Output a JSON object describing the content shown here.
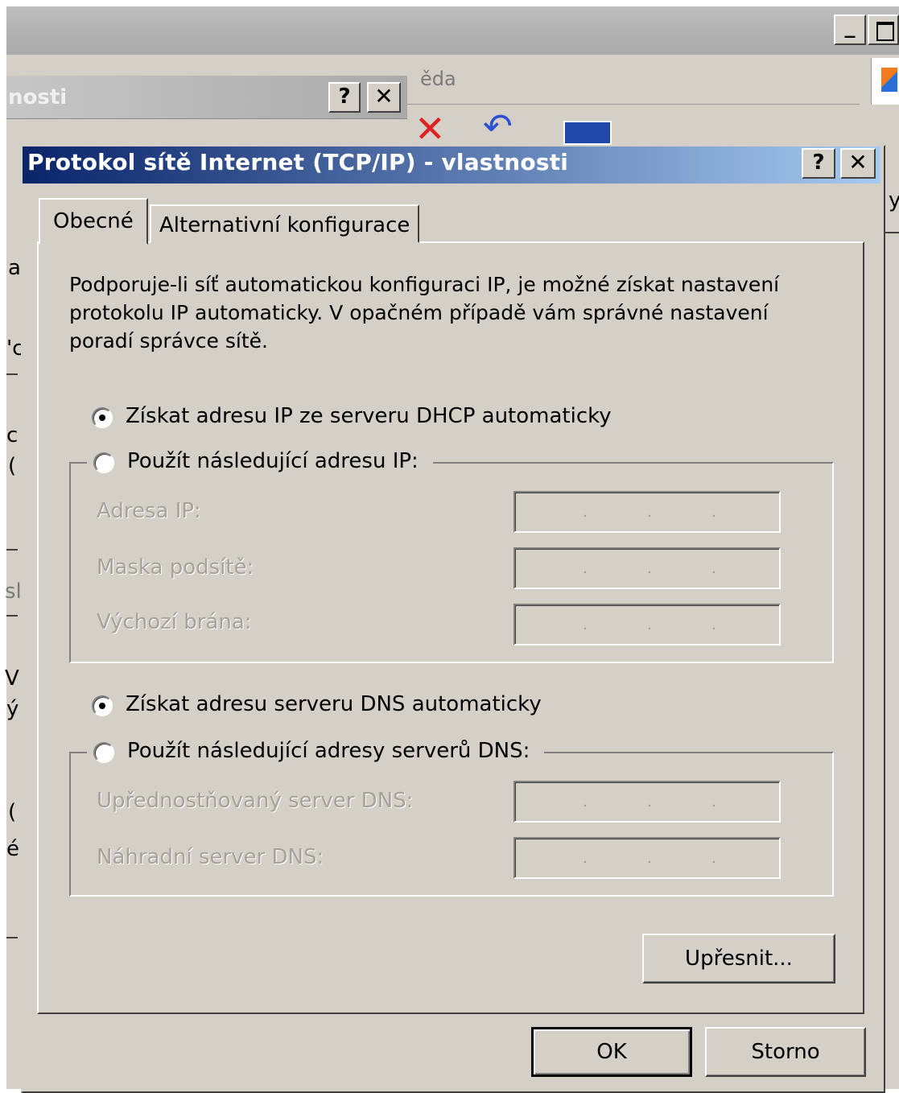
{
  "background": {
    "menu_fragment": "ěda",
    "properties_title_fragment": "nosti",
    "help_symbol": "?",
    "close_symbol": "✕",
    "minimize_symbol": "_",
    "left_edge_fragments": [
      "a",
      "'c",
      "c",
      "(",
      "sl",
      "V|",
      "ý",
      "(",
      "é"
    ],
    "right_edge_fragment": "y"
  },
  "dialog": {
    "title": "Protokol sítě Internet (TCP/IP) - vlastnosti",
    "help_label": "?",
    "close_label": "✕",
    "tabs": [
      {
        "label": "Obecné",
        "selected": true
      },
      {
        "label": "Alternativní konfigurace",
        "selected": false
      }
    ],
    "intro_lines": [
      "Podporuje-li síť automatickou konfiguraci IP, je možné získat nastavení",
      "protokolu IP automaticky. V opačném případě vám správné nastavení",
      "poradí správce sítě."
    ],
    "ip_auto_label": "Získat adresu IP ze serveru DHCP automaticky",
    "ip_manual_label": "Použít následující adresu IP:",
    "ip_fields": [
      {
        "label": "Adresa IP:",
        "value": ""
      },
      {
        "label": "Maska podsítě:",
        "value": ""
      },
      {
        "label": "Výchozí brána:",
        "value": ""
      }
    ],
    "dns_auto_label": "Získat adresu serveru DNS automaticky",
    "dns_manual_label": "Použít následující adresy serverů DNS:",
    "dns_fields": [
      {
        "label": "Upřednostňovaný server DNS:",
        "value": ""
      },
      {
        "label": "Náhradní server DNS:",
        "value": ""
      }
    ],
    "ip_dot": ".",
    "advanced_button": "Upřesnit...",
    "ok_button": "OK",
    "cancel_button": "Storno",
    "selected_ip_mode": "auto",
    "selected_dns_mode": "auto"
  }
}
